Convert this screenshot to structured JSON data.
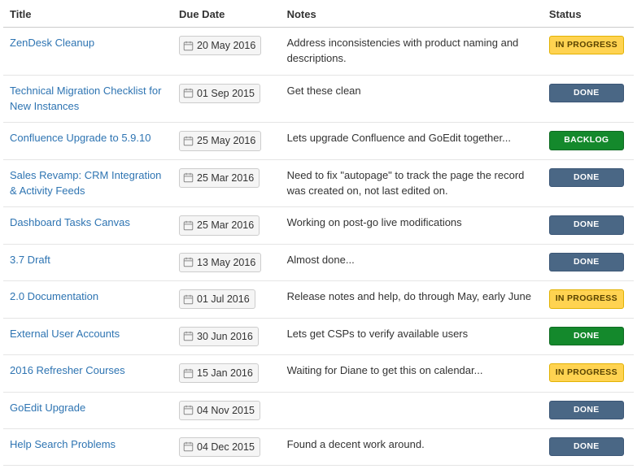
{
  "columns": {
    "title": "Title",
    "due": "Due Date",
    "notes": "Notes",
    "status": "Status"
  },
  "status_labels": {
    "in_progress": "IN PROGRESS",
    "done": "DONE",
    "backlog": "BACKLOG"
  },
  "rows": [
    {
      "title": "ZenDesk Cleanup",
      "due": "20 May 2016",
      "notes": "Address inconsistencies with product naming and descriptions.",
      "status": "in_progress",
      "status_style": "inprogress"
    },
    {
      "title": "Technical Migration Checklist for New Instances",
      "due": "01 Sep 2015",
      "notes": "Get these clean",
      "status": "done",
      "status_style": "done"
    },
    {
      "title": "Confluence Upgrade to 5.9.10",
      "due": "25 May 2016",
      "notes": "Lets upgrade Confluence and GoEdit together...",
      "status": "backlog",
      "status_style": "backlog"
    },
    {
      "title": "Sales Revamp: CRM Integration & Activity Feeds",
      "due": "25 Mar 2016",
      "notes": "Need to fix \"autopage\" to track the page the record was created on, not last edited on.",
      "status": "done",
      "status_style": "done"
    },
    {
      "title": "Dashboard Tasks Canvas",
      "due": "25 Mar 2016",
      "notes": "Working on post-go live modifications",
      "status": "done",
      "status_style": "done"
    },
    {
      "title": "3.7 Draft",
      "due": "13 May 2016",
      "notes": "Almost done...",
      "status": "done",
      "status_style": "done"
    },
    {
      "title": "2.0 Documentation",
      "due": "01 Jul 2016",
      "notes": "Release notes and help, do through May, early June",
      "status": "in_progress",
      "status_style": "inprogress"
    },
    {
      "title": "External User Accounts",
      "due": "30 Jun 2016",
      "notes": "Lets get CSPs to verify available users",
      "status": "done",
      "status_style": "done-green"
    },
    {
      "title": "2016 Refresher Courses",
      "due": "15 Jan 2016",
      "notes": "Waiting for Diane to get this on calendar...",
      "status": "in_progress",
      "status_style": "inprogress"
    },
    {
      "title": "GoEdit Upgrade",
      "due": "04 Nov 2015",
      "notes": "",
      "status": "done",
      "status_style": "done"
    },
    {
      "title": "Help Search Problems",
      "due": "04 Dec 2015",
      "notes": "Found a decent work around.",
      "status": "done",
      "status_style": "done"
    }
  ]
}
